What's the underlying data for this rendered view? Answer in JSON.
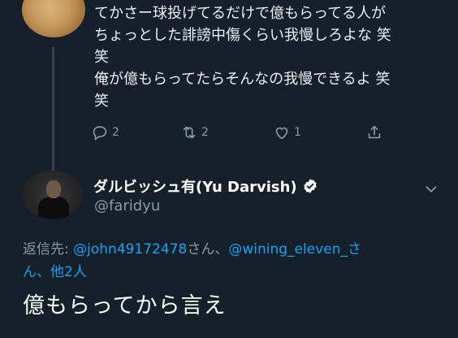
{
  "tweet1": {
    "text_line1": "てかさー球投げてるだけで億もらってる人が",
    "text_line2": "ちょっとした誹謗中傷くらい我慢しろよな 笑",
    "text_line3": "笑",
    "text_line4": "俺が億もらってたらそんなの我慢できるよ 笑",
    "text_line5": "笑",
    "reply_count": "2",
    "retweet_count": "2",
    "like_count": "1"
  },
  "tweet2": {
    "display_name": "ダルビッシュ有(Yu Darvish)",
    "handle": "@faridyu",
    "reply_prefix": "返信先: ",
    "mention1": "@john49172478",
    "san1": "さん、",
    "mention2": "@wining_eleven_",
    "san2": "さ",
    "line2": "ん、他2人",
    "text": "億もらってから言え"
  },
  "colors": {
    "background": "#15202b",
    "accent": "#1da1f2",
    "muted": "#8899a6"
  },
  "icons": [
    "reply-icon",
    "retweet-icon",
    "like-icon",
    "share-icon",
    "verified-badge-icon",
    "chevron-down-icon"
  ]
}
